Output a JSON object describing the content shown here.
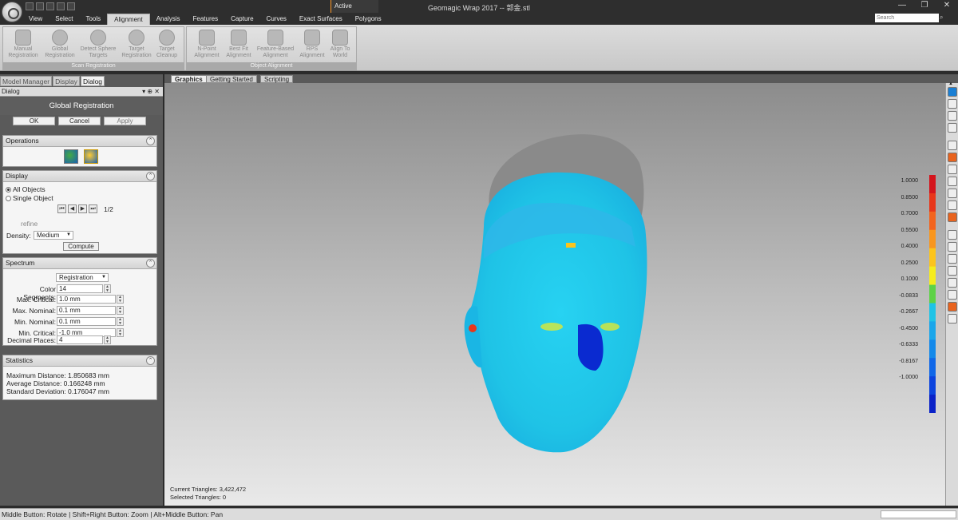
{
  "window": {
    "title": "Geomagic Wrap 2017 -- 郭金.stl",
    "active_label": "Active",
    "search_placeholder": "Search",
    "minimize": "—",
    "restore": "❐",
    "close": "✕"
  },
  "ribbon_tabs": [
    "View",
    "Select",
    "Tools",
    "Alignment",
    "Analysis",
    "Features",
    "Capture",
    "Curves",
    "Exact Surfaces",
    "Polygons"
  ],
  "ribbon": {
    "scan_registration": {
      "label": "Scan Registration",
      "buttons": [
        "Manual\nRegistration",
        "Global\nRegistration",
        "Detect Sphere\nTargets",
        "Target\nRegistration",
        "Target\nCleanup"
      ]
    },
    "object_alignment": {
      "label": "Object Alignment",
      "buttons": [
        "N-Point\nAlignment",
        "Best Fit\nAlignment",
        "Feature-Based\nAlignment",
        "RPS\nAlignment",
        "Align To\nWorld"
      ]
    }
  },
  "panel_tabs": [
    "Model Manager",
    "Display",
    "Dialog"
  ],
  "dialog": {
    "header": "Dialog",
    "header_controls": "▾ ⊕ ✕",
    "title": "Global Registration",
    "ok": "OK",
    "cancel": "Cancel",
    "apply": "Apply"
  },
  "operations": {
    "title": "Operations"
  },
  "display": {
    "title": "Display",
    "all_objects": "All Objects",
    "single_object": "Single Object",
    "page": "1/2",
    "refine": "refine",
    "density_label": "Density:",
    "density_value": "Medium",
    "compute": "Compute"
  },
  "spectrum": {
    "title": "Spectrum",
    "type": "Registration",
    "rows": [
      {
        "label": "Color Segments:",
        "value": "14"
      },
      {
        "label": "Max. Critical:",
        "value": "1.0 mm"
      },
      {
        "label": "Max. Nominal:",
        "value": "0.1 mm"
      },
      {
        "label": "Min. Nominal:",
        "value": "0.1 mm"
      },
      {
        "label": "Min. Critical:",
        "value": "-1.0 mm"
      },
      {
        "label": "Decimal Places:",
        "value": "4"
      }
    ]
  },
  "statistics": {
    "title": "Statistics",
    "max": "Maximum Distance: 1.850683 mm",
    "avg": "Average Distance: 0.166248 mm",
    "std": "Standard Deviation: 0.176047 mm"
  },
  "view_tabs": [
    "Graphics",
    "Getting Started",
    "Scripting"
  ],
  "viewport": {
    "current_triangles": "Current Triangles: 3,422,472",
    "selected_triangles": "Selected Triangles: 0"
  },
  "colorbar": {
    "labels": [
      "1.0000",
      "0.8500",
      "0.7000",
      "0.5500",
      "0.4000",
      "0.2500",
      "0.1000",
      "-0.0833",
      "-0.2667",
      "-0.4500",
      "-0.6333",
      "-0.8167",
      "-1.0000"
    ],
    "colors": [
      "#d4141c",
      "#e8361a",
      "#f2641e",
      "#f8961e",
      "#fcc41c",
      "#f6ec1c",
      "#5ed246",
      "#1fc3e6",
      "#1aa6ea",
      "#1489ea",
      "#1067e8",
      "#0c44de",
      "#0a22c8"
    ]
  },
  "statusbar": {
    "text": "Middle Button: Rotate | Shift+Right Button: Zoom | Alt+Middle Button: Pan"
  },
  "nav_glyphs": [
    "⏮",
    "◀",
    "▶",
    "⏭"
  ]
}
